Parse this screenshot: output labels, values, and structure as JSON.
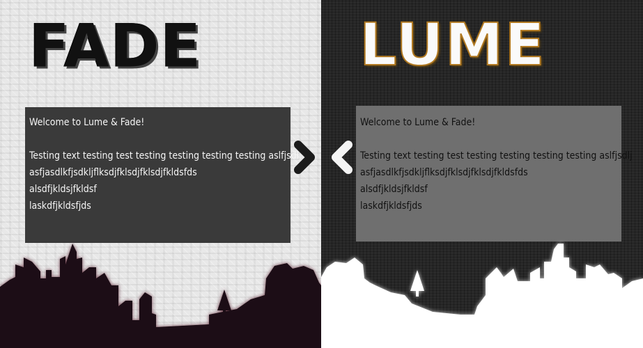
{
  "fade": {
    "logo": "FADE",
    "panel": {
      "lines": [
        "Welcome to Lume & Fade!",
        "",
        "Testing text testing test testing testing testing testing aslfjsdlj",
        "asfjasdlkfjsdkljflksdjfklsdjfklsdjfkldsfds",
        "alsdfjkldsjfkldsf",
        "laskdfjkldsfjds"
      ]
    }
  },
  "lume": {
    "logo": "LUME",
    "panel": {
      "lines": [
        "Welcome to Lume & Fade!",
        "",
        "Testing text testing test testing testing testing testing aslfjsdlj",
        "asfjasdlkfjsdkljflksdjfklsdjfklsdjfkldsfds",
        "alsdfjkldsjfkldsf",
        "laskdfjkldsfjds"
      ]
    }
  },
  "icons": {
    "fade_arrow": "chevron-right-icon",
    "lume_arrow": "chevron-left-icon"
  },
  "colors": {
    "fade_background": "#e8e8e8",
    "lume_background": "#262626",
    "fade_panel": "#3a3a3a",
    "lume_panel": "#6f6f6f",
    "fade_skyline": "#1a0d12",
    "lume_skyline": "#ffffff",
    "lume_logo_outline": "#b07820"
  }
}
